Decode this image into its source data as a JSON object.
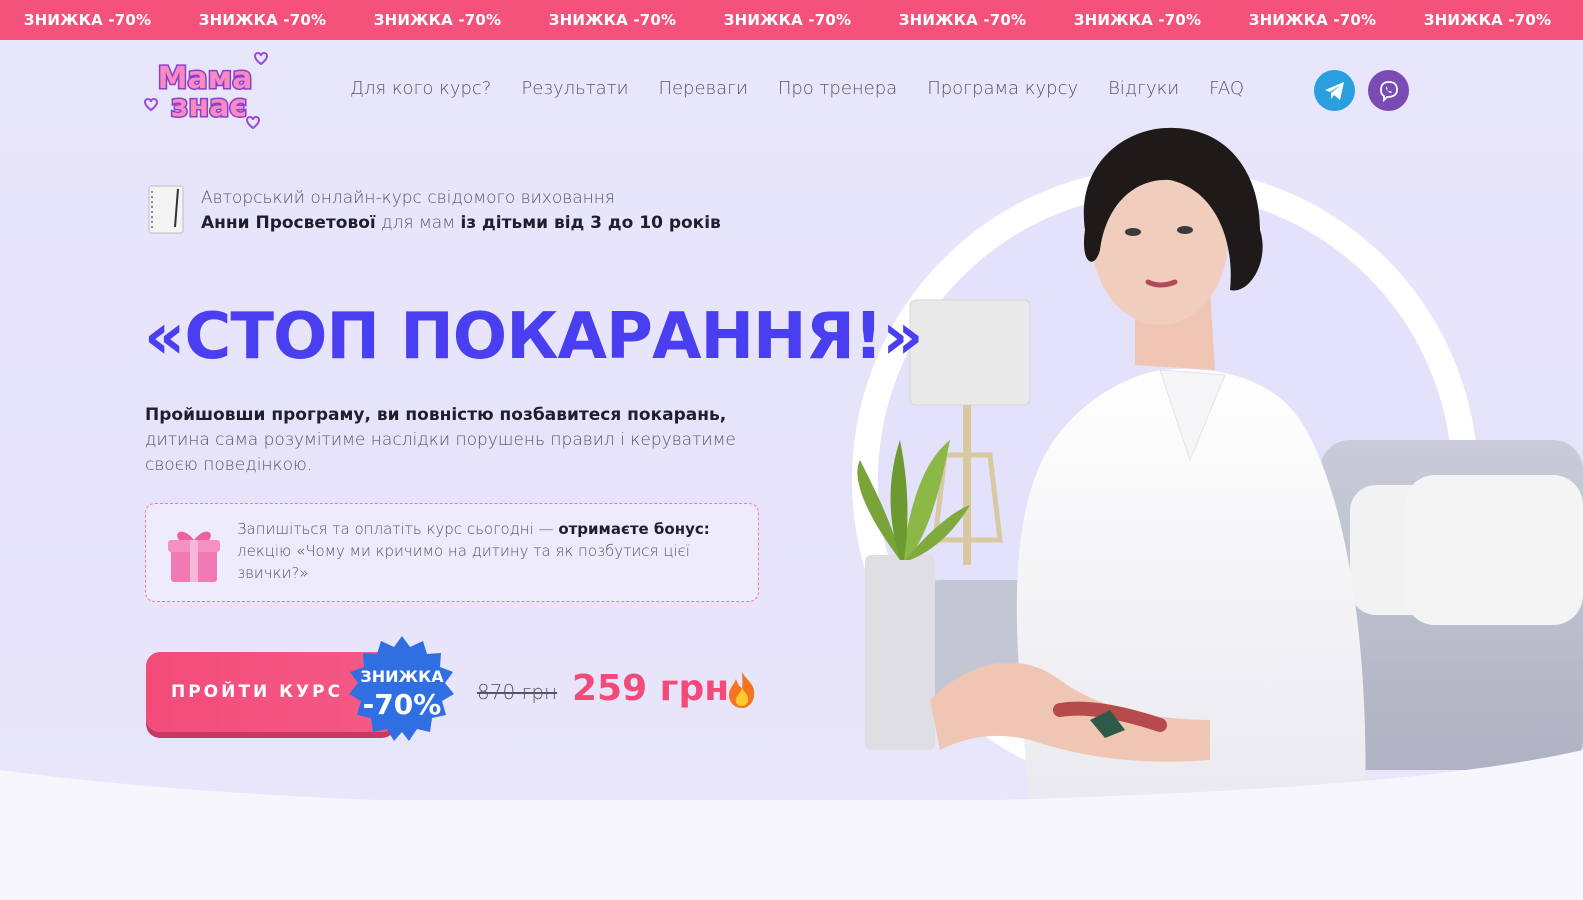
{
  "promo": {
    "items": [
      "ЗНИЖКА -70%",
      "ЗНИЖКА -70%",
      "ЗНИЖКА -70%",
      "ЗНИЖКА -70%",
      "ЗНИЖКА -70%",
      "ЗНИЖКА -70%",
      "ЗНИЖКА -70%",
      "ЗНИЖКА -70%",
      "ЗНИЖКА -70%"
    ],
    "color": "#f4527b"
  },
  "header": {
    "logo": {
      "line1": "Мама",
      "line2": "знає"
    },
    "nav": [
      "Для кого курс?",
      "Результати",
      "Переваги",
      "Про тренера",
      "Програма курсу",
      "Відгуки",
      "FAQ"
    ],
    "social": [
      {
        "name": "telegram-icon",
        "color": "#2a9fe0"
      },
      {
        "name": "viber-icon",
        "color": "#7a4bb3"
      }
    ]
  },
  "hero": {
    "subtitle_line1": "Авторський онлайн-курс свідомого виховання",
    "subtitle_author": "Анни Просветової",
    "subtitle_mid": " для мам ",
    "subtitle_children": "із дітьми від 3 до 10 років",
    "title": "«СТОП ПОКАРАННЯ!»",
    "desc_bold": "Пройшовши програму, ви повністю позбавитеся покарань,",
    "desc_rest": " дитина сама розумітиме наслідки порушень правил і керуватиме своєю поведінкою.",
    "bonus_start": "Запишіться та оплатіть курс сьогодні — ",
    "bonus_bold": "отримаєте бонус:",
    "bonus_rest": " лекцію «Чому ми кричимо на дитину та як позбутися цієї звички?»",
    "cta_label": "ПРОЙТИ КУРС",
    "badge_top": "ЗНИЖКА",
    "badge_value": "-70%",
    "old_price": "870 грн",
    "new_price": "259 грн",
    "accent": "#4a3ff0",
    "pink": "#f24b7a"
  }
}
